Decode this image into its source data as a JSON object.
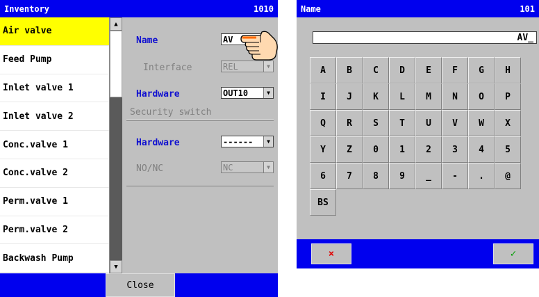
{
  "inventory": {
    "title": "Inventory",
    "code": "1010",
    "items": [
      "Air valve",
      "Feed Pump",
      "Inlet valve 1",
      "Inlet valve 2",
      "Conc.valve 1",
      "Conc.valve 2",
      "Perm.valve 1",
      "Perm.valve 2",
      "Backwash Pump"
    ],
    "selected_index": 0,
    "fields": {
      "name_label": "Name",
      "name_value": "AV",
      "interface_label": "Interface",
      "interface_value": "REL",
      "hardware_label": "Hardware",
      "hardware_value": "OUT10",
      "security_label": "Security switch",
      "sec_hardware_label": "Hardware",
      "sec_hardware_value": "------",
      "nonc_label": "NO/NC",
      "nonc_value": "NC"
    },
    "close_label": "Close"
  },
  "keyboard": {
    "title": "Name",
    "code": "101",
    "input_value": "AV_",
    "rows": [
      [
        "A",
        "B",
        "C",
        "D",
        "E",
        "F",
        "G",
        "H"
      ],
      [
        "I",
        "J",
        "K",
        "L",
        "M",
        "N",
        "O",
        "P"
      ],
      [
        "Q",
        "R",
        "S",
        "T",
        "U",
        "V",
        "W",
        "X"
      ],
      [
        "Y",
        "Z",
        "0",
        "1",
        "2",
        "3",
        "4",
        "5"
      ],
      [
        "6",
        "7",
        "8",
        "9",
        "_",
        "-",
        ".",
        "@"
      ],
      [
        "BS"
      ]
    ],
    "cancel_label": "×",
    "ok_label": "✓"
  },
  "colors": {
    "title_bar": "#0000ee",
    "selected": "#ffff00",
    "label_blue": "#1010d0"
  }
}
